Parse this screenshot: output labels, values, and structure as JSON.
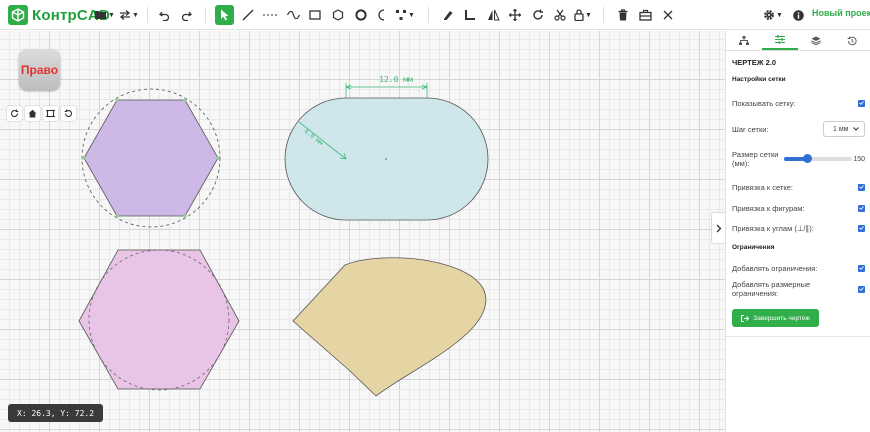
{
  "app": {
    "name": "КонтрCAD",
    "project_label": "Новый проект",
    "accent": "#2fae4a"
  },
  "toolbar": {
    "file_menu": "folder-icon",
    "transfer_menu": "swap-icon",
    "undo": "undo-icon",
    "redo": "redo-icon",
    "tools": [
      "select",
      "line",
      "construction-line",
      "spline",
      "rectangle",
      "polygon",
      "circle",
      "arc",
      "points"
    ],
    "edit": [
      "pen",
      "corner",
      "mirror",
      "move",
      "rotate",
      "scissors",
      "lock"
    ],
    "actions": [
      "delete",
      "align",
      "close"
    ],
    "settings": "gear-icon",
    "info": "info-icon"
  },
  "view": {
    "cube_label": "Право"
  },
  "status": {
    "coords": "X: 26.3, Y: 72.2"
  },
  "dimensions": {
    "length": "12.0 мм",
    "radius": "6.0 мм"
  },
  "panel": {
    "tabs": [
      "tree",
      "properties",
      "layers",
      "history"
    ],
    "active_tab": 1,
    "title": "ЧЕРТЕЖ 2.0",
    "grid_section": "Настройки сетки",
    "show_grid": {
      "label": "Показывать сетку:",
      "checked": true
    },
    "grid_step": {
      "label": "Шаг сетки:",
      "value": "1 мм"
    },
    "grid_size": {
      "label": "Размер сетки (мм):",
      "value": "150",
      "fraction": 0.35
    },
    "snap_grid": {
      "label": "Привязка к сетке:",
      "checked": true
    },
    "snap_shapes": {
      "label": "Привязка к фигурам:",
      "checked": true
    },
    "snap_angles": {
      "label": "Привязка к углам (⊥/∥):",
      "checked": true
    },
    "constraints_section": "Ограничения",
    "add_constraints": {
      "label": "Добавлять ограничения:",
      "checked": true
    },
    "add_dim_constraints": {
      "label": "Добавлять размерные ограничения:",
      "checked": true
    },
    "finish_button": "Завершить чертеж"
  },
  "colors": {
    "hexagon_top": "#cdb8e6",
    "slot": "#cfe6ea",
    "hexagon_bottom": "#e8c4e6",
    "blob": "#e5d4a4",
    "dimension": "#3cb878",
    "checkbox": "#2f6fd6"
  }
}
